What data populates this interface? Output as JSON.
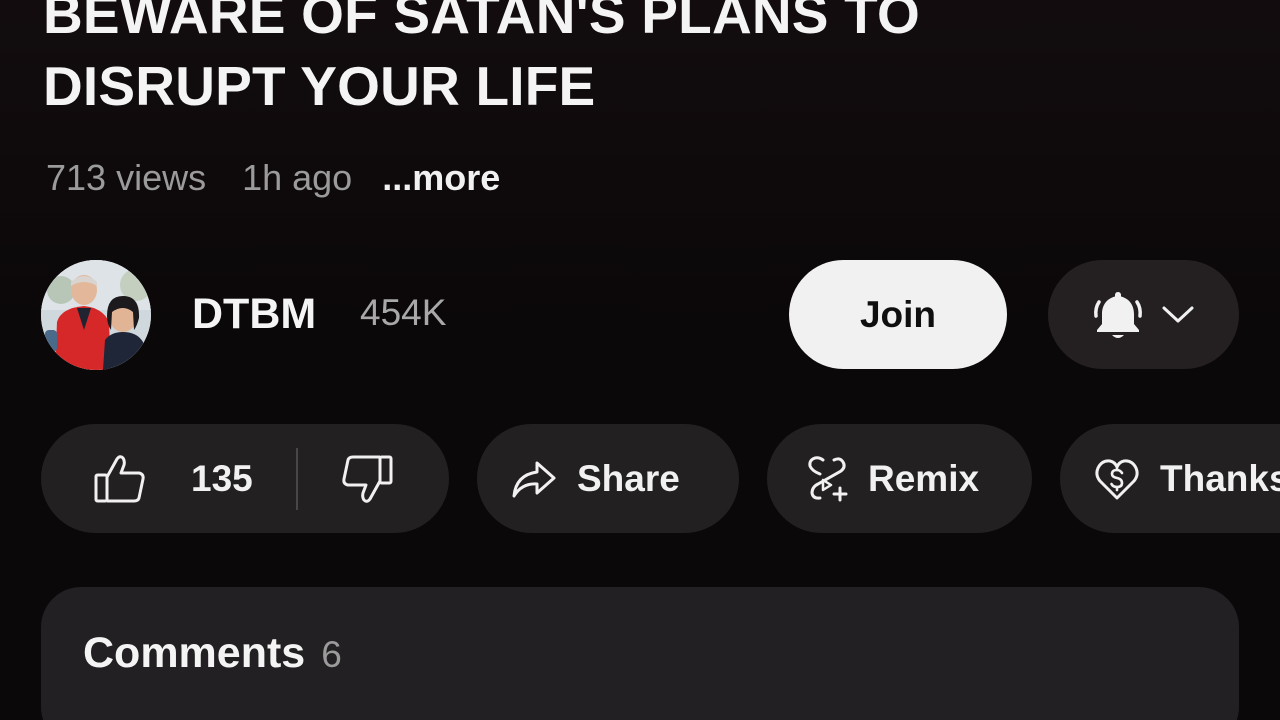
{
  "video": {
    "title_line1": "BEWARE OF SATAN'S PLANS TO",
    "title_line2": "DISRUPT YOUR LIFE",
    "views": "713 views",
    "time_ago": "1h ago",
    "more_label": "...more"
  },
  "channel": {
    "name": "DTBM",
    "subscribers": "454K",
    "join_label": "Join",
    "notify_icon": "bell-icon",
    "dropdown_icon": "chevron-down-icon"
  },
  "actions": {
    "like_count": "135",
    "like_icon": "thumbs-up-icon",
    "dislike_icon": "thumbs-down-icon",
    "share_label": "Share",
    "share_icon": "share-arrow-icon",
    "remix_label": "Remix",
    "remix_icon": "remix-icon",
    "thanks_label": "Thanks",
    "thanks_icon": "heart-dollar-icon"
  },
  "comments": {
    "title": "Comments",
    "count": "6"
  },
  "colors": {
    "background": "#0f0b0d",
    "pill_background": "#232021",
    "join_background": "#f1f1f1",
    "muted_text": "#9b9b9b"
  }
}
